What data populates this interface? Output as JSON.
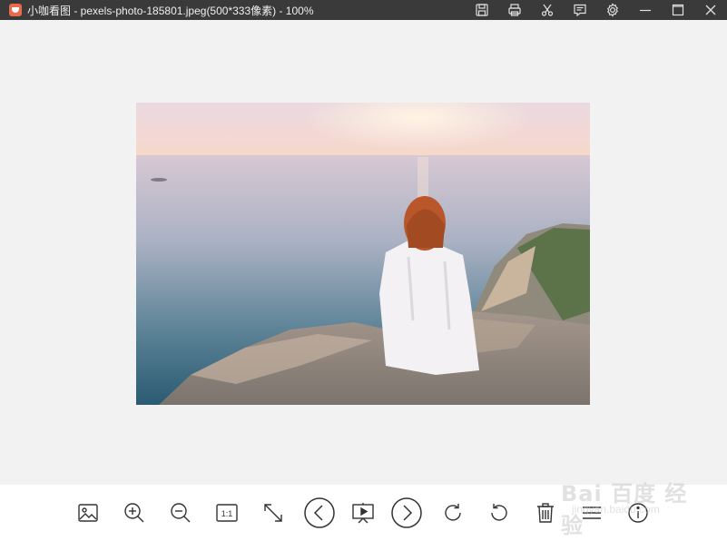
{
  "window": {
    "title": "小咖看图 - pexels-photo-185801.jpeg(500*333像素) - 100%"
  },
  "title_actions": [
    {
      "name": "save-icon"
    },
    {
      "name": "print-icon"
    },
    {
      "name": "cut-icon"
    },
    {
      "name": "feedback-icon"
    },
    {
      "name": "settings-icon"
    },
    {
      "name": "minimize-icon"
    },
    {
      "name": "maximize-icon"
    },
    {
      "name": "close-icon"
    }
  ],
  "toolbar": {
    "actual_size_label": "1:1",
    "tools": [
      "open-image",
      "zoom-in",
      "zoom-out",
      "actual-size",
      "fit-screen",
      "previous",
      "slideshow",
      "next",
      "rotate-clockwise",
      "rotate-counterclockwise",
      "delete",
      "menu",
      "info"
    ]
  },
  "watermark": {
    "text": "Bai 百度 经验",
    "sub": "jingyan.baidu.com"
  },
  "colors": {
    "titlebar": "#3a3a3a",
    "canvas": "#f2f2f2",
    "toolbar": "#ffffff",
    "icon": "#333333"
  }
}
